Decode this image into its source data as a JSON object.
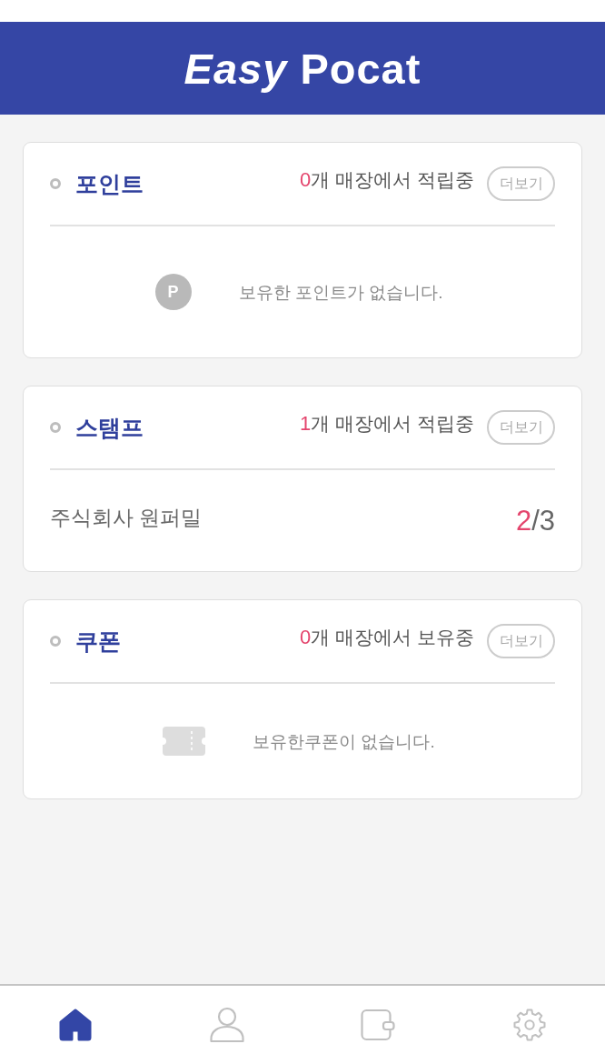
{
  "header": {
    "logo": "*Easy* Pocat"
  },
  "cards": [
    {
      "kind": "points",
      "title": "포인트",
      "count": "0",
      "summary": "개 매장에서 적립중",
      "more_button": "더보기",
      "empty": {
        "icon_letter": "P",
        "message": "보유한 포인트가 없습니다."
      }
    },
    {
      "kind": "stamps",
      "title": "스탬프",
      "count": "1",
      "summary": "개 매장에서 적립중",
      "more_button": "더보기",
      "rows": [
        {
          "store": "주식회사 원퍼밀",
          "collected": "2",
          "goal": "/3"
        }
      ]
    },
    {
      "kind": "coupons",
      "title": "쿠폰",
      "count": "0",
      "summary": "개 매장에서 보유중",
      "more_button": "더보기",
      "empty": {
        "message": "보유한쿠폰이 없습니다."
      }
    }
  ],
  "bottom_nav": [
    {
      "kind": "home",
      "selected": true
    },
    {
      "kind": "person",
      "selected": false
    },
    {
      "kind": "wallet",
      "selected": false
    },
    {
      "kind": "settings",
      "selected": false
    }
  ]
}
